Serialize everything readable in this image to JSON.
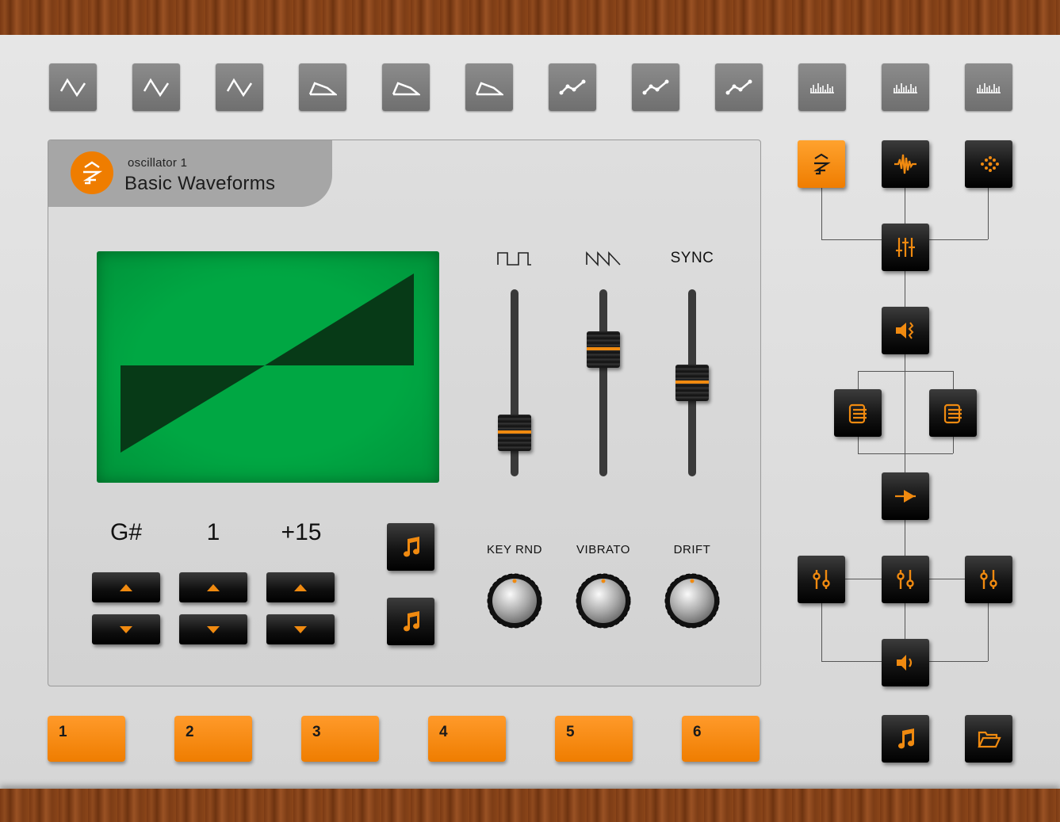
{
  "waveform_presets": [
    {
      "icon": "triangle-wave-icon"
    },
    {
      "icon": "triangle-wave-icon"
    },
    {
      "icon": "triangle-wave-icon"
    },
    {
      "icon": "trapezoid-wave-icon"
    },
    {
      "icon": "trapezoid-wave-icon"
    },
    {
      "icon": "trapezoid-wave-icon"
    },
    {
      "icon": "line-graph-wave-icon"
    },
    {
      "icon": "line-graph-wave-icon"
    },
    {
      "icon": "line-graph-wave-icon"
    },
    {
      "icon": "spectrum-bars-icon"
    },
    {
      "icon": "spectrum-bars-icon"
    },
    {
      "icon": "spectrum-bars-icon"
    }
  ],
  "oscillator": {
    "subtitle": "oscillator 1",
    "title": "Basic Waveforms",
    "logo_icon": "oscillator-logo-icon",
    "screen_color": "#00a743",
    "waveform": "sawtooth"
  },
  "tuning": {
    "note": "G#",
    "octave": "1",
    "fine": "+15"
  },
  "faders": [
    {
      "label": "",
      "icon": "square-wave-icon",
      "level": 0.2
    },
    {
      "label": "",
      "icon": "saw-wave-icon",
      "level": 0.7
    },
    {
      "label": "SYNC",
      "level": 0.5
    }
  ],
  "knobs": [
    {
      "label": "KEY RND"
    },
    {
      "label": "VIBRATO"
    },
    {
      "label": "DRIFT"
    }
  ],
  "side_buttons": [
    {
      "icon": "music-note-icon"
    },
    {
      "icon": "music-note-icon"
    }
  ],
  "signal_flow": [
    {
      "icon": "oscillator-icon",
      "active": true
    },
    {
      "icon": "waveform-icon",
      "active": false
    },
    {
      "icon": "noise-icon",
      "active": false
    },
    {
      "icon": "mixer-icon",
      "active": false
    },
    {
      "icon": "speaker-modulation-icon",
      "active": false
    },
    {
      "icon": "filter-stack-icon",
      "active": false
    },
    {
      "icon": "filter-stack-icon",
      "active": false
    },
    {
      "icon": "arrow-right-icon",
      "active": false
    },
    {
      "icon": "adjust-sliders-icon",
      "active": false
    },
    {
      "icon": "adjust-sliders-icon",
      "active": false
    },
    {
      "icon": "adjust-sliders-icon",
      "active": false
    },
    {
      "icon": "volume-icon",
      "active": false
    },
    {
      "icon": "music-note-icon",
      "active": false
    },
    {
      "icon": "folder-open-icon",
      "active": false
    }
  ],
  "presets": [
    "1",
    "2",
    "3",
    "4",
    "5",
    "6"
  ],
  "colors": {
    "accent": "#ef7d00",
    "screen": "#00a743"
  }
}
